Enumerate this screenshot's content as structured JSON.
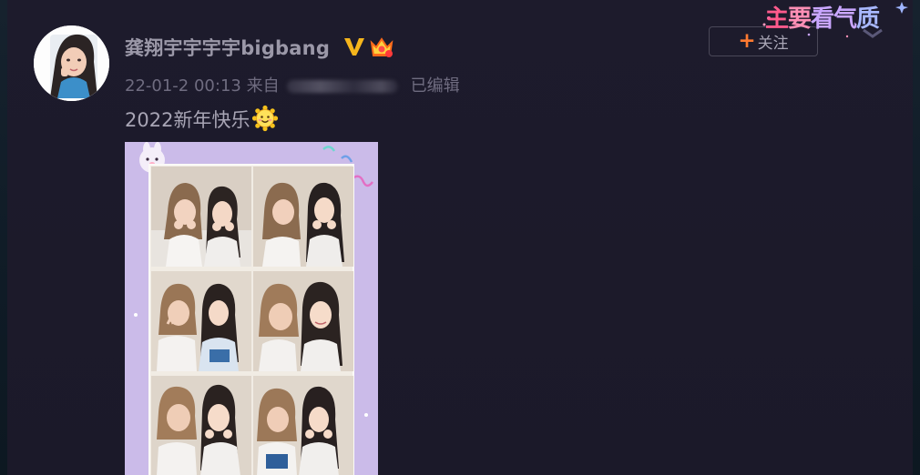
{
  "post": {
    "username": "龚翔宇宇宇宇bigbang",
    "timestamp": "22-01-2 00:13",
    "source_prefix": "来自",
    "edited_label": "已编辑",
    "text": "2022新年快乐",
    "emoji": "sun-smile-emoji"
  },
  "follow_button": {
    "plus": "+",
    "label": "关注"
  },
  "watermark": {
    "part1": "主",
    "part2": "要",
    "part3": "看气",
    "part4": "质"
  },
  "badges": {
    "verified": "V",
    "verified_color": "#f5b51c",
    "crown_color": "#ff6a1a"
  },
  "colors": {
    "background": "#1c1a2b",
    "follow_plus": "#ff7a30",
    "image_frame": "#c7b7e8"
  }
}
